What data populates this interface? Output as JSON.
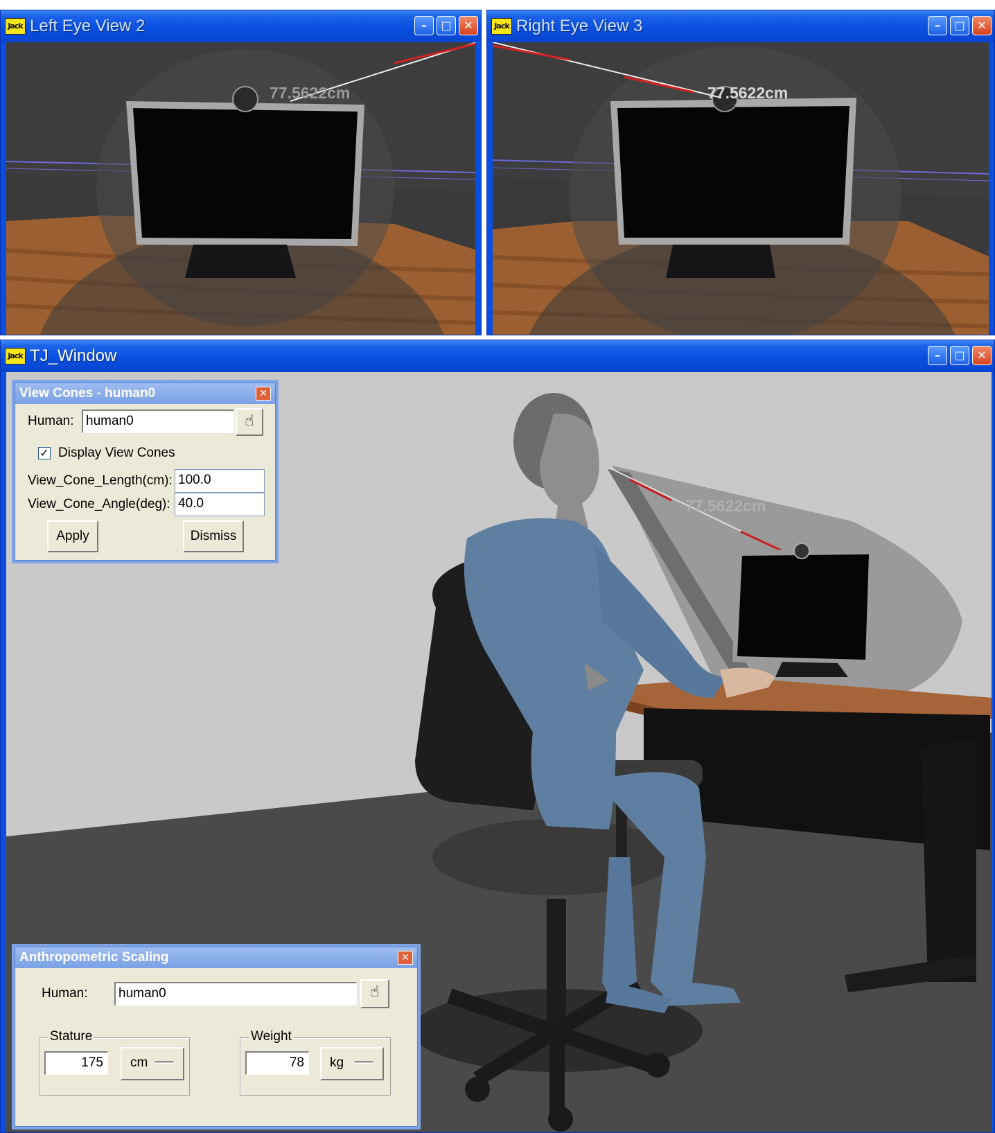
{
  "windows": {
    "left_eye": {
      "title": "Left Eye View 2",
      "distance": "77.5622cm"
    },
    "right_eye": {
      "title": "Right Eye View 3",
      "distance": "77.5622cm"
    },
    "main": {
      "title": "TJ_Window",
      "distance": "77.5622cm"
    }
  },
  "app_icon_text": "Jack",
  "caption_buttons": {
    "minimize": "–",
    "maximize": "□",
    "close": "✕"
  },
  "view_cones": {
    "title": "View Cones - human0",
    "human_label": "Human:",
    "human_value": "human0",
    "display_checkbox_label": "Display View Cones",
    "display_checked": true,
    "length_label": "View_Cone_Length(cm):",
    "length_value": "100.0",
    "angle_label": "View_Cone_Angle(deg):",
    "angle_value": "40.0",
    "apply_label": "Apply",
    "dismiss_label": "Dismiss"
  },
  "anthro": {
    "title": "Anthropometric Scaling",
    "human_label": "Human:",
    "human_value": "human0",
    "stature_label": "Stature",
    "stature_value": "175",
    "stature_unit": "cm",
    "weight_label": "Weight",
    "weight_value": "78",
    "weight_unit": "kg"
  },
  "colors": {
    "title_blue": "#0a4fe0",
    "dialog_face": "#ece9d8",
    "desk_wood": "#a0643a",
    "figure_blue": "#5f7fa1"
  }
}
